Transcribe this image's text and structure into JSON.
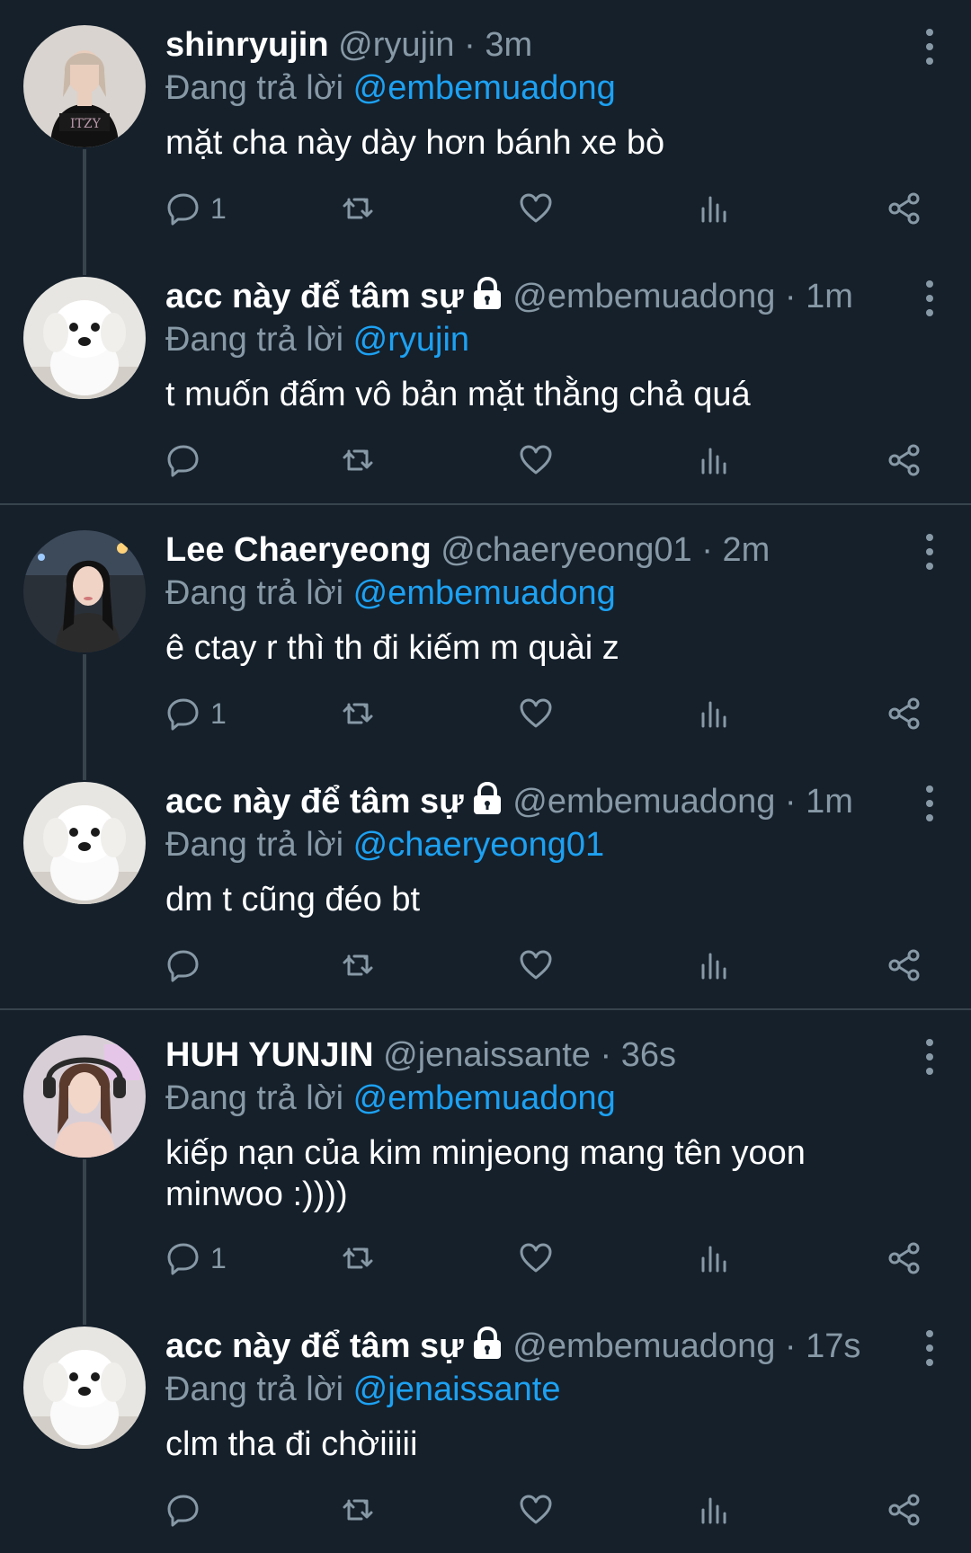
{
  "colors": {
    "background": "#15202b",
    "divider": "#38444d",
    "secondary_text": "#8899a6",
    "link_blue": "#1da1f2"
  },
  "reply_prefix": "Đang trả lời",
  "icons": {
    "reply": "comment-bubble-icon",
    "retweet": "retweet-icon",
    "like": "heart-icon",
    "analytics": "bar-chart-icon",
    "share": "share-icon",
    "more": "more-vertical-icon",
    "protected": "lock-icon"
  },
  "threads": [
    {
      "tweets": [
        {
          "name": "shinryujin",
          "handle": "@ryujin",
          "sep": "·",
          "time": "3m",
          "protected": false,
          "reply_to": "@embemuadong",
          "text": "mặt cha này dày hơn bánh xe bò",
          "reply_count": "1",
          "avatar": "woman-black-top"
        },
        {
          "name": "acc này để tâm sự",
          "handle": "@embemuadong",
          "sep": "·",
          "time": "1m",
          "protected": true,
          "reply_to": "@ryujin",
          "text": "t muốn đấm vô bản mặt thằng chả quá",
          "reply_count": "",
          "avatar": "white-puppy"
        }
      ]
    },
    {
      "tweets": [
        {
          "name": "Lee Chaeryeong",
          "handle": "@chaeryeong01",
          "sep": "·",
          "time": "2m",
          "protected": false,
          "reply_to": "@embemuadong",
          "text": "ê ctay r thì th đi kiếm m quài z",
          "reply_count": "1",
          "avatar": "woman-night-city"
        },
        {
          "name": "acc này để tâm sự",
          "handle": "@embemuadong",
          "sep": "·",
          "time": "1m",
          "protected": true,
          "reply_to": "@chaeryeong01",
          "text": "dm t cũng đéo bt",
          "reply_count": "",
          "avatar": "white-puppy"
        }
      ]
    },
    {
      "tweets": [
        {
          "name": "HUH YUNJIN",
          "handle": "@jenaissante",
          "sep": "·",
          "time": "36s",
          "protected": false,
          "reply_to": "@embemuadong",
          "text": "kiếp nạn của kim minjeong mang tên yoon minwoo :))))",
          "reply_count": "1",
          "avatar": "woman-headphones"
        },
        {
          "name": "acc này để tâm sự",
          "handle": "@embemuadong",
          "sep": "·",
          "time": "17s",
          "protected": true,
          "reply_to": "@jenaissante",
          "text": "clm tha đi chờiiiii",
          "reply_count": "",
          "avatar": "white-puppy"
        }
      ]
    }
  ]
}
